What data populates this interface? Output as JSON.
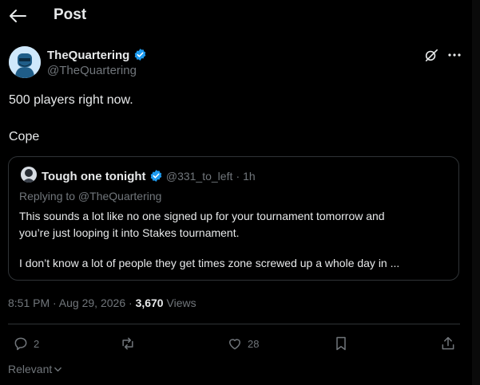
{
  "header": {
    "title": "Post"
  },
  "post": {
    "author_name": "TheQuartering",
    "author_handle": "@TheQuartering",
    "lines": [
      "500 players right now.",
      "Cope"
    ],
    "timestamp": "8:51 PM · Aug 29, 2026",
    "separator": " · ",
    "views_count": "3,670",
    "views_label": " Views"
  },
  "quote": {
    "author_name": "Tough one tonight",
    "author_handle": "@331_to_left",
    "age": "· 1h",
    "replying_to": "Replying to @TheQuartering",
    "lines": [
      "This sounds a lot like no one signed up for your tournament tomorrow and",
      "you’re just looping it into Stakes tournament.",
      "I don’t know a lot of people they get times zone screwed up a whole day in ..."
    ]
  },
  "actions": {
    "replies": "2",
    "reposts": "",
    "likes": "28"
  },
  "sort": {
    "label": "Relevant"
  },
  "colors": {
    "accent": "#1d9bf0",
    "text": "#e7e9ea",
    "muted": "#71767b",
    "border": "#2f3336"
  }
}
